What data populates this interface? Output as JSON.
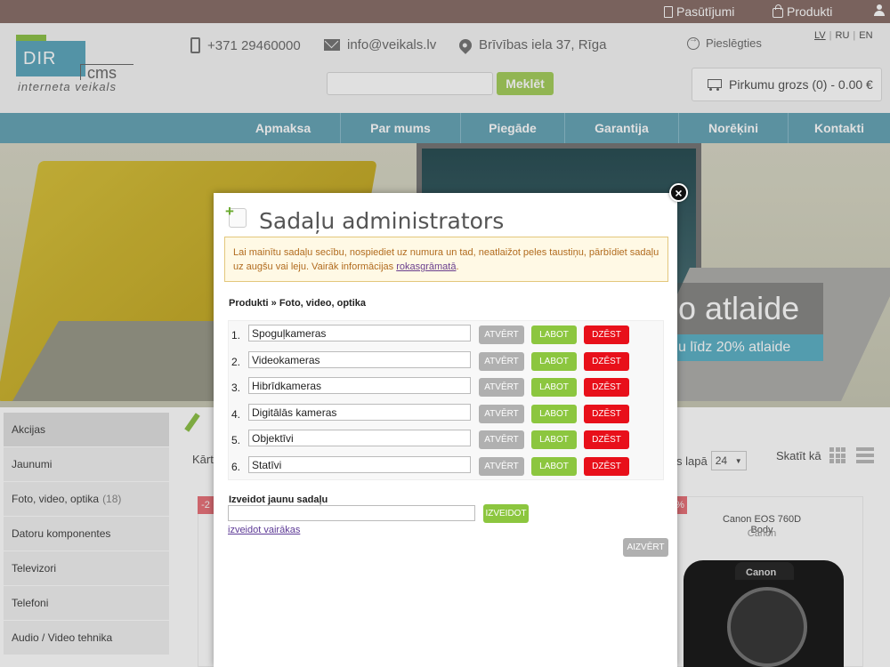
{
  "topbar": {
    "orders_label": "Pasūtījumi",
    "products_label": "Produkti"
  },
  "header": {
    "logo_main": "DIR",
    "logo_cms": "cms",
    "logo_sub": "interneta veikals",
    "phone": "+371 29460000",
    "email": "info@veikals.lv",
    "address": "Brīvības iela 37, Rīga",
    "login_label": "Pieslēgties",
    "languages": [
      "LV",
      "RU",
      "EN"
    ],
    "search_button": "Meklēt",
    "cart_label": "Pirkumu grozs (0) - 0.00 €"
  },
  "nav": {
    "items": [
      "Apmaksa",
      "Par mums",
      "Piegāde",
      "Garantija",
      "Norēķini",
      "Kontakti"
    ]
  },
  "banner": {
    "promo_big": "o atlaide",
    "promo_small": "u līdz 20% atlaide"
  },
  "sidebar": {
    "items": [
      {
        "label": "Akcijas",
        "count": ""
      },
      {
        "label": "Jaunumi",
        "count": ""
      },
      {
        "label": "Foto, video, optika",
        "count": "(18)"
      },
      {
        "label": "Datoru komponentes",
        "count": ""
      },
      {
        "label": "Televizori",
        "count": ""
      },
      {
        "label": "Telefoni",
        "count": ""
      },
      {
        "label": "Audio / Video tehnika",
        "count": ""
      }
    ]
  },
  "listing": {
    "sort_label": "Kārt",
    "per_page_label": "s lapā",
    "per_page_value": "24",
    "view_label": "Skatīt kā",
    "badge_left": "-2",
    "badge_right": "%",
    "product_name": "Canon EOS 760D Body",
    "product_brand": "Canon",
    "camera_logo": "Canon"
  },
  "modal": {
    "title": "Sadaļu administrators",
    "notice_text": "Lai mainītu sadaļu secību, nospiediet uz numura un tad, neatlaižot peles taustiņu, pārbīdiet sadaļu uz augšu vai leju. Vairāk informācijas ",
    "notice_link": "rokasgrāmatā",
    "notice_end": ".",
    "breadcrumb": "Produkti » Foto, video, optika",
    "open_label": "ATVĒRT",
    "edit_label": "LABOT",
    "delete_label": "DZĒST",
    "categories": [
      {
        "num": "1.",
        "name": "Spoguļkameras"
      },
      {
        "num": "2.",
        "name": "Videokameras"
      },
      {
        "num": "3.",
        "name": "Hibrīdkameras"
      },
      {
        "num": "4.",
        "name": "Digitālās kameras"
      },
      {
        "num": "5.",
        "name": "Objektīvi"
      },
      {
        "num": "6.",
        "name": "Statīvi"
      }
    ],
    "new_section_label": "Izveidot jaunu sadaļu",
    "create_label": "IZVEIDOT",
    "create_more_label": "izveidot vairākas",
    "close_label": "AIZVĒRT",
    "close_icon": "×"
  }
}
